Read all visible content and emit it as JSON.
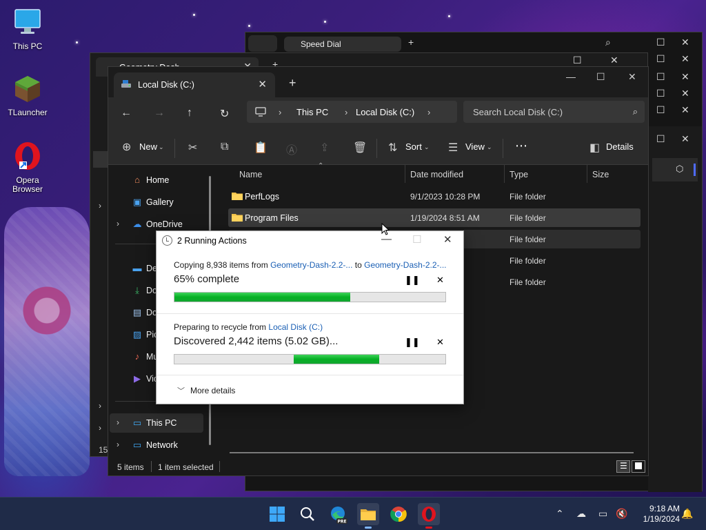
{
  "desktop": {
    "icons": [
      {
        "label": "This PC"
      },
      {
        "label": "TLauncher"
      },
      {
        "label": "Opera Browser"
      }
    ]
  },
  "background_windows": {
    "browser_tab": "Speed Dial",
    "explorer_tab": "Geometry Dash",
    "partial_number": "15"
  },
  "explorer": {
    "tab_title": "Local Disk (C:)",
    "breadcrumb": [
      "This PC",
      "Local Disk (C:)"
    ],
    "search_placeholder": "Search Local Disk (C:)",
    "toolbar": {
      "new_label": "New",
      "sort_label": "Sort",
      "view_label": "View",
      "details_label": "Details"
    },
    "nav": {
      "home": "Home",
      "gallery": "Gallery",
      "onedrive": "OneDrive",
      "desktop": "De",
      "downloads": "Do",
      "documents": "Do",
      "pictures": "Pic",
      "music": "Mu",
      "videos": "Vic",
      "this_pc": "This PC",
      "network": "Network"
    },
    "columns": {
      "name": "Name",
      "date": "Date modified",
      "type": "Type",
      "size": "Size"
    },
    "files": [
      {
        "name": "PerfLogs",
        "date": "9/1/2023 10:28 PM",
        "type": "File folder"
      },
      {
        "name": "Program Files",
        "date": "1/19/2024 8:51 AM",
        "type": "File folder"
      },
      {
        "name": "",
        "date": "M",
        "type": "File folder"
      },
      {
        "name": "",
        "date": "M",
        "type": "File folder"
      },
      {
        "name": "",
        "date": "M",
        "type": "File folder"
      }
    ],
    "status": {
      "count": "5 items",
      "selected": "1 item selected"
    }
  },
  "dialog": {
    "title": "2 Running Actions",
    "op1": {
      "prefix": "Copying 8,938 items from ",
      "from": "Geometry-Dash-2.2-...",
      "mid": " to ",
      "to": "Geometry-Dash-2.2-...",
      "status": "65% complete",
      "progress": 0.65
    },
    "op2": {
      "prefix": "Preparing to recycle from ",
      "from": "Local Disk (C:)",
      "status": "Discovered 2,442 items (5.02 GB)...",
      "progress_start": 0.44,
      "progress_end": 0.756
    },
    "more_details": "More details"
  },
  "taskbar": {
    "time": "9:18 AM",
    "date": "1/19/2024",
    "accent": "#7fb6ff"
  }
}
